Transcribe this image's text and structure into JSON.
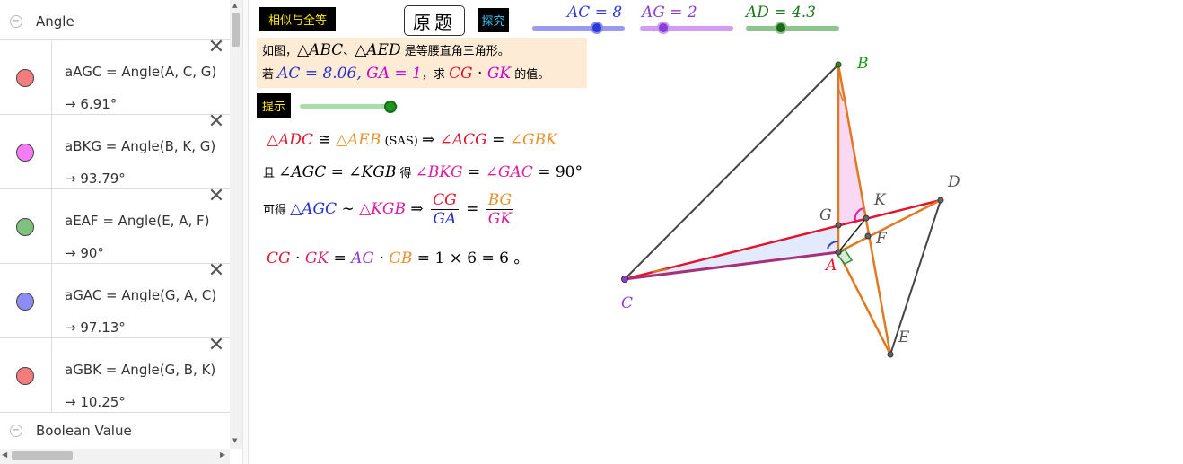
{
  "algebra": {
    "groups": [
      {
        "title": "Angle"
      },
      {
        "title": "Boolean Value"
      }
    ],
    "items": [
      {
        "definition": "aAGC = Angle(A, C, G)",
        "value": "→  6.91°",
        "color": "#f47c7c"
      },
      {
        "definition": "aBKG = Angle(B, K, G)",
        "value": "→  93.79°",
        "color": "#f47cf4"
      },
      {
        "definition": "aEAF = Angle(E, A, F)",
        "value": "→  90°",
        "color": "#7fc27f"
      },
      {
        "definition": "aGAC = Angle(G, A, C)",
        "value": "→  97.13°",
        "color": "#8c8cf4"
      },
      {
        "definition": "aGBK = Angle(G, B, K)",
        "value": "→  10.25°",
        "color": "#f47c7c"
      }
    ],
    "close_glyph": "✕",
    "collapse_glyph": "−"
  },
  "toolbar": {
    "similar_button": "相似与全等",
    "original_button": "原题",
    "explore_button": "探究",
    "hint_button": "提示"
  },
  "sliders": [
    {
      "label": "AC = 8",
      "value": 8,
      "color": "#4040d8"
    },
    {
      "label": "AG = 2",
      "value": 2,
      "color": "#8a3dd8"
    },
    {
      "label": "AD = 4.3",
      "value": 4.3,
      "color": "#1a7a1a"
    }
  ],
  "hint_slider": {
    "value": 1,
    "color": "#1a9a1a"
  },
  "problem": {
    "line1_a": "如图，",
    "line1_tri1": "△ABC",
    "line1_sep": "、",
    "line1_tri2": "△AED",
    "line1_b": " 是等腰直角三角形。",
    "line2_a": "若 ",
    "line2_given": "AC = 8.06, ",
    "line2_given2": "GA = 1",
    "line2_b": "，求 ",
    "line2_cg": "CG",
    "line2_dot": " · ",
    "line2_gk": "GK",
    "line2_c": " 的值。"
  },
  "solution": {
    "l1_t1": "△ADC",
    "l1_cong": " ≅ ",
    "l1_t2": "△AEB",
    "l1_sas": " (SAS) ",
    "l1_arrow": "⇒ ",
    "l1_a1": "∠ACG",
    "l1_eq": " = ",
    "l1_a2": "∠GBK",
    "l2_and": "且 ",
    "l2_a": "∠AGC = ∠KGB",
    "l2_get": " 得 ",
    "l2_b": "∠BKG",
    "l2_eq": " = ",
    "l2_c": "∠GAC",
    "l2_d": " = 90°",
    "l3_get": "可得 ",
    "l3_t1": "△AGC",
    "l3_sim": " ∼ ",
    "l3_t2": "△KGB",
    "l3_arrow": " ⇒ ",
    "l3_f1n": "CG",
    "l3_f1d": "GA",
    "l3_eq": " = ",
    "l3_f2n": "BG",
    "l3_f2d": "GK",
    "l4_cg": "CG",
    "l4_dot": " · ",
    "l4_gk": "GK",
    "l4_eq": " = ",
    "l4_ag": "AG",
    "l4_dot2": " · ",
    "l4_gb": "GB",
    "l4_rest": "  =  1 ×  6  =  6 。"
  },
  "figure": {
    "point_labels": {
      "A": "A",
      "B": "B",
      "C": "C",
      "D": "D",
      "E": "E",
      "F": "F",
      "G": "G",
      "K": "K"
    }
  }
}
